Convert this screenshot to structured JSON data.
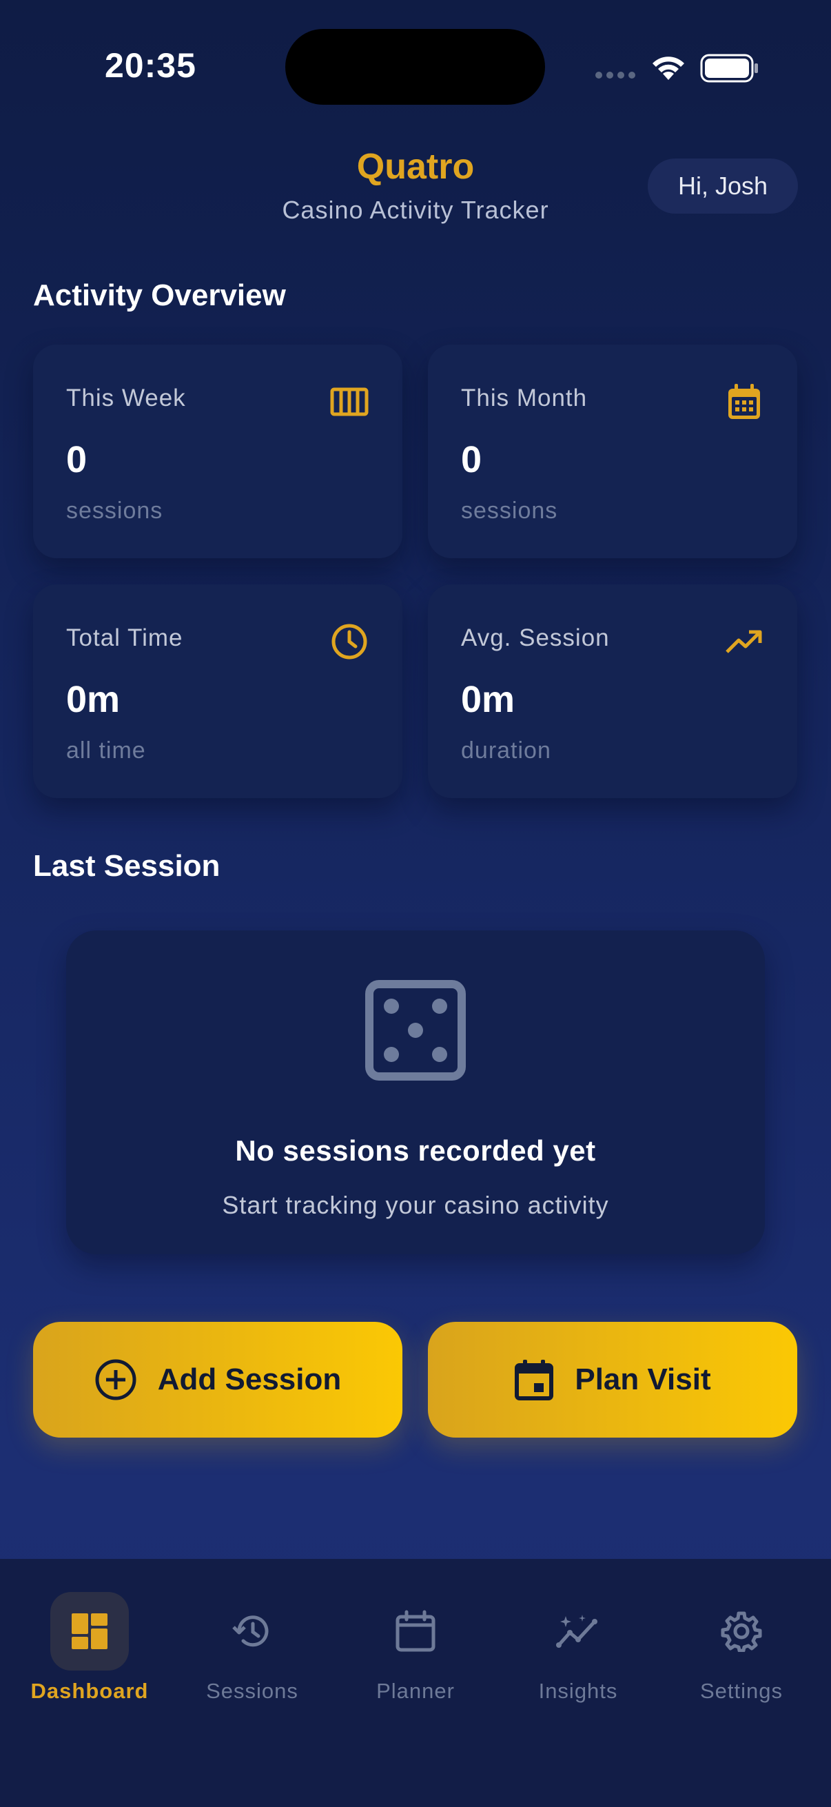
{
  "status_bar": {
    "time": "20:35"
  },
  "header": {
    "title": "Quatro",
    "subtitle": "Casino Activity Tracker",
    "greeting": "Hi, Josh"
  },
  "overview": {
    "title": "Activity Overview",
    "cards": [
      {
        "label": "This Week",
        "value": "0",
        "sub": "sessions",
        "icon": "columns-icon"
      },
      {
        "label": "This Month",
        "value": "0",
        "sub": "sessions",
        "icon": "calendar-icon"
      },
      {
        "label": "Total Time",
        "value": "0m",
        "sub": "all time",
        "icon": "clock-icon"
      },
      {
        "label": "Avg. Session",
        "value": "0m",
        "sub": "duration",
        "icon": "trending-up-icon"
      }
    ]
  },
  "last_session": {
    "title": "Last Session",
    "empty_title": "No sessions recorded yet",
    "empty_subtitle": "Start tracking your casino activity",
    "icon": "dice-icon"
  },
  "actions": {
    "add_session": "Add Session",
    "plan_visit": "Plan Visit"
  },
  "tabbar": {
    "items": [
      {
        "label": "Dashboard",
        "icon": "dashboard-icon",
        "active": true
      },
      {
        "label": "Sessions",
        "icon": "history-icon",
        "active": false
      },
      {
        "label": "Planner",
        "icon": "calendar-icon",
        "active": false
      },
      {
        "label": "Insights",
        "icon": "insights-icon",
        "active": false
      },
      {
        "label": "Settings",
        "icon": "gear-icon",
        "active": false
      }
    ]
  },
  "colors": {
    "accent": "#e0a520",
    "button_gradient_start": "#d9a41c",
    "button_gradient_end": "#fbc804",
    "background_top": "#0f1c45",
    "card": "#142352",
    "inactive": "#6e7a98"
  }
}
